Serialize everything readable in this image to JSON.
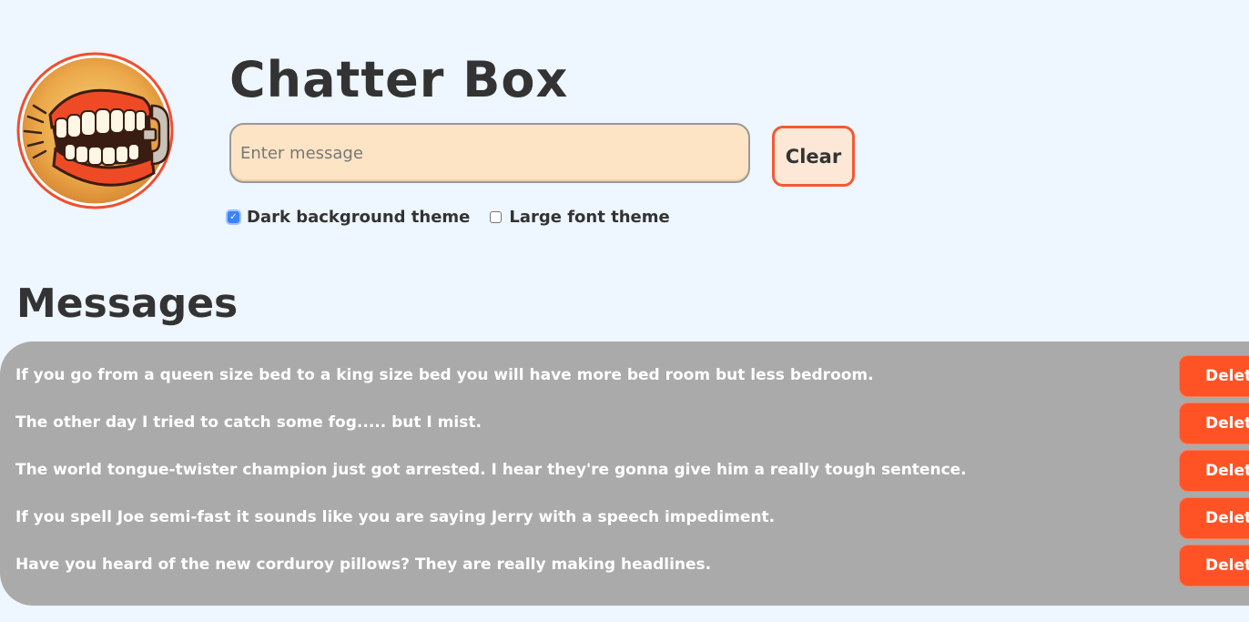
{
  "app": {
    "title": "Chatter Box",
    "logo_icon": "chattering-teeth-icon"
  },
  "composer": {
    "placeholder": "Enter message",
    "value": "",
    "clear_label": "Clear"
  },
  "themes": [
    {
      "label": "Dark background theme",
      "checked": true
    },
    {
      "label": "Large font theme",
      "checked": false
    }
  ],
  "messages": {
    "heading": "Messages",
    "delete_label": "Delete",
    "items": [
      "If you go from a queen size bed to a king size bed you will have more bed room but less bedroom.",
      "The other day I tried to catch some fog..... but I mist.",
      "The world tongue-twister champion just got arrested. I hear they're gonna give him a really tough sentence.",
      "If you spell Joe semi-fast it sounds like you are saying Jerry with a speech impediment.",
      "Have you heard of the new corduroy pillows? They are really making headlines."
    ]
  },
  "colors": {
    "page_background": "#eef6ff",
    "accent": "#f35a32",
    "delete_button": "#ff5326",
    "messages_panel": "#aaaaaa",
    "input_background": "#fde4c4",
    "checkbox_checked": "#3b82f6"
  }
}
